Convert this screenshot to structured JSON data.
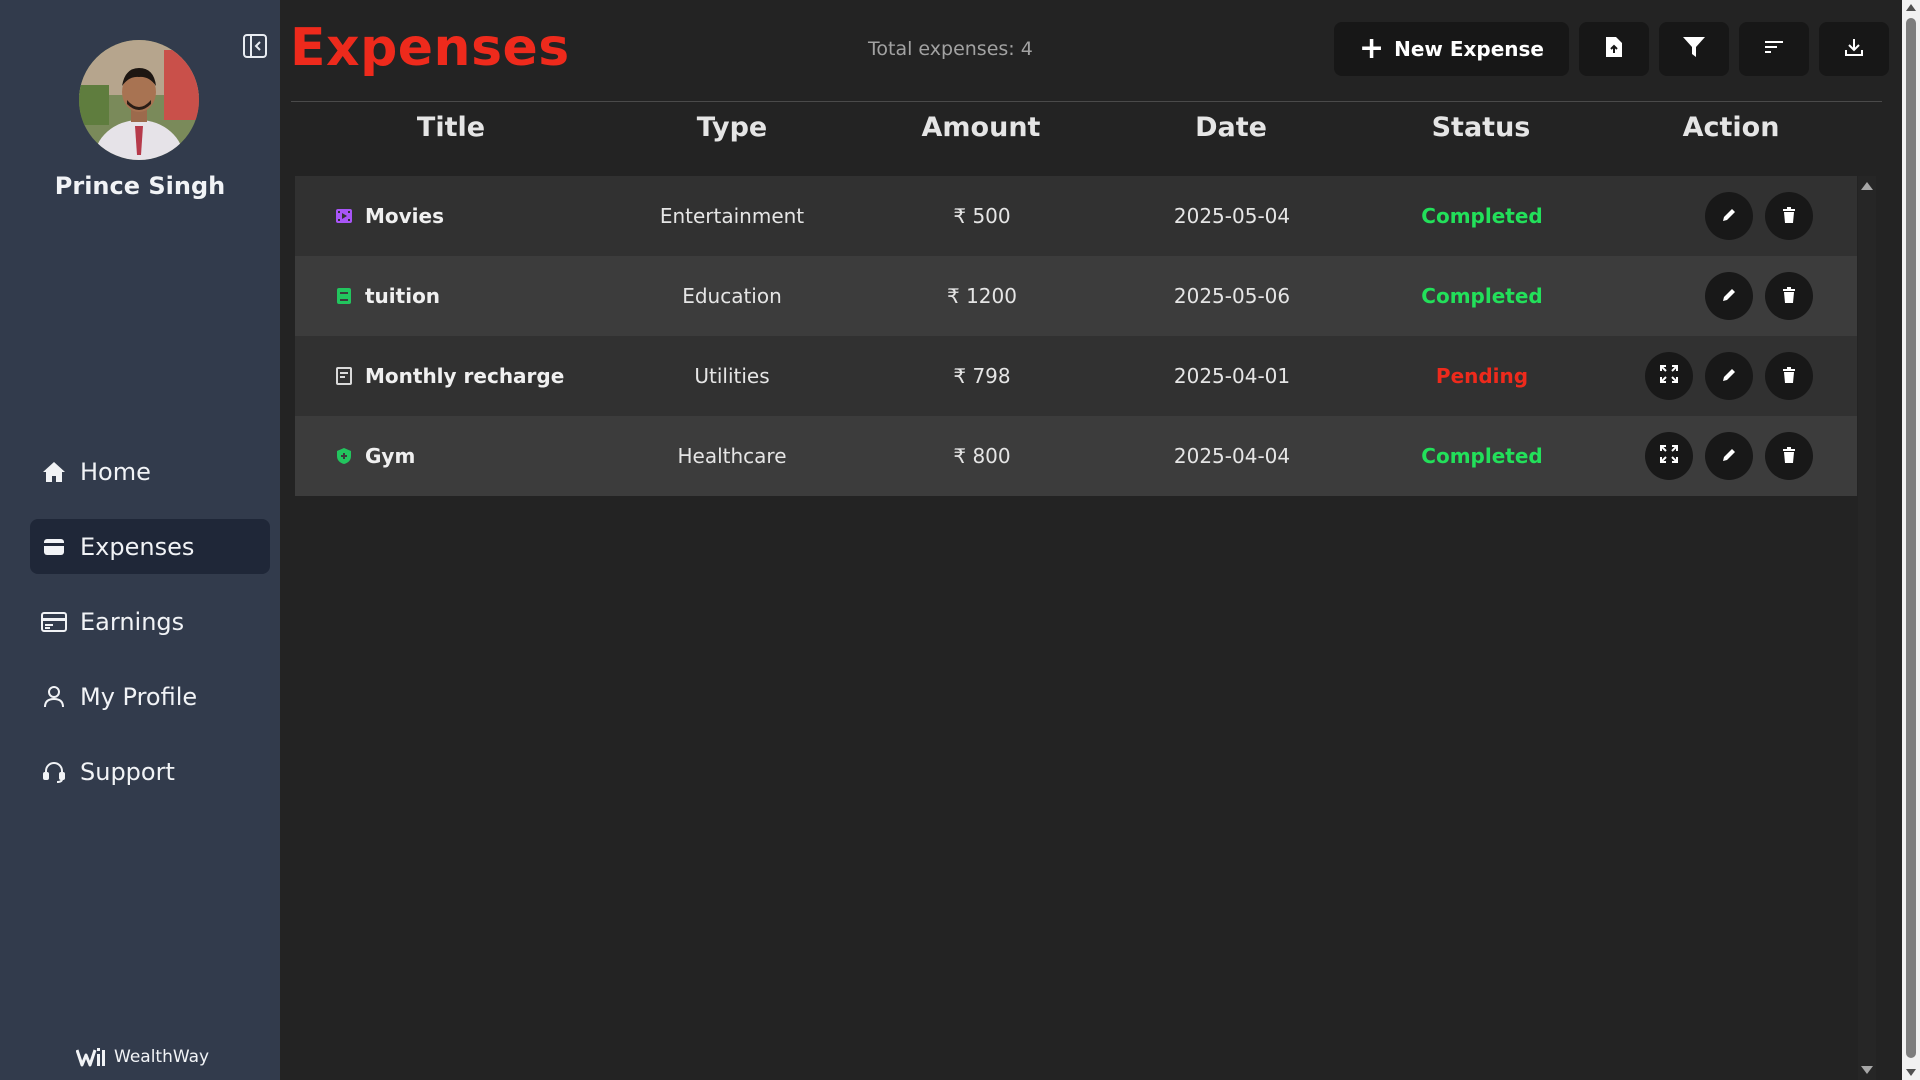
{
  "sidebar": {
    "user_name": "Prince Singh",
    "nav": [
      {
        "label": "Home",
        "icon": "home-icon",
        "active": false
      },
      {
        "label": "Expenses",
        "icon": "wallet-icon",
        "active": true
      },
      {
        "label": "Earnings",
        "icon": "card-icon",
        "active": false
      },
      {
        "label": "My Profile",
        "icon": "user-icon",
        "active": false
      },
      {
        "label": "Support",
        "icon": "headset-icon",
        "active": false
      }
    ],
    "brand": "WealthWay"
  },
  "header": {
    "title": "Expenses",
    "total_label": "Total expenses: 4",
    "new_button": "New Expense"
  },
  "table": {
    "columns": [
      "Title",
      "Type",
      "Amount",
      "Date",
      "Status",
      "Action"
    ],
    "rows": [
      {
        "title": "Movies",
        "icon": "film-icon",
        "icon_color": "#a855f7",
        "type": "Entertainment",
        "amount": "₹ 500",
        "date": "2025-05-04",
        "status": "Completed",
        "status_color": "#22e05a",
        "actions": [
          "edit",
          "delete"
        ]
      },
      {
        "title": "tuition",
        "icon": "book-icon",
        "icon_color": "#22c55e",
        "type": "Education",
        "amount": "₹ 1200",
        "date": "2025-05-06",
        "status": "Completed",
        "status_color": "#22e05a",
        "actions": [
          "edit",
          "delete"
        ]
      },
      {
        "title": "Monthly recharge",
        "icon": "receipt-icon",
        "icon_color": "#d9d9d9",
        "type": "Utilities",
        "amount": "₹ 798",
        "date": "2025-04-01",
        "status": "Pending",
        "status_color": "#ee2a1c",
        "actions": [
          "expand",
          "edit",
          "delete"
        ]
      },
      {
        "title": "Gym",
        "icon": "shield-icon",
        "icon_color": "#22c55e",
        "type": "Healthcare",
        "amount": "₹ 800",
        "date": "2025-04-04",
        "status": "Completed",
        "status_color": "#22e05a",
        "actions": [
          "expand",
          "edit",
          "delete"
        ]
      }
    ]
  },
  "colors": {
    "accent": "#ee2a1c",
    "sidebar_bg": "#323b4c",
    "completed": "#22e05a",
    "pending": "#ee2a1c"
  }
}
